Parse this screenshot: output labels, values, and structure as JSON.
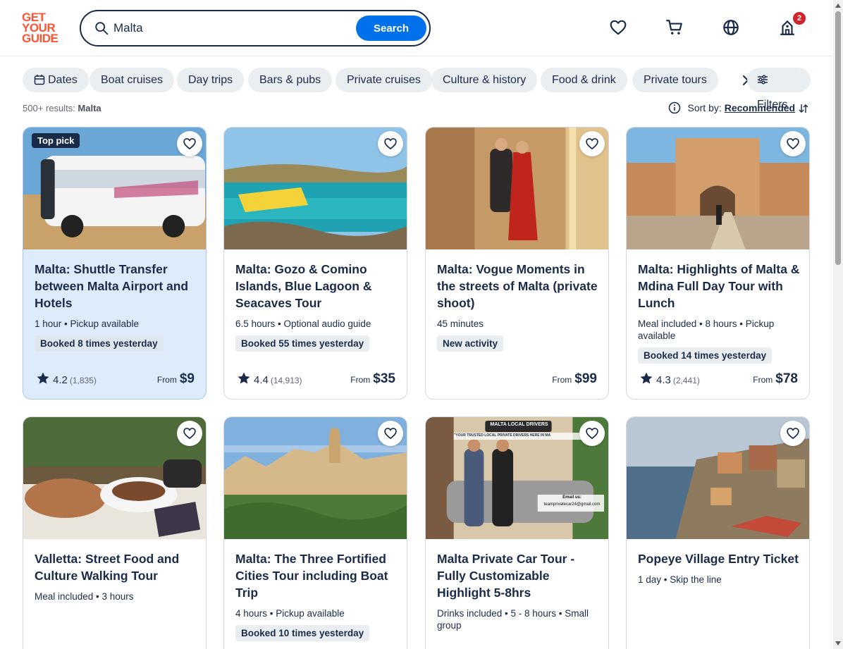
{
  "header": {
    "logo_lines": [
      "GET",
      "YOUR",
      "GUIDE"
    ],
    "search_value": "Malta",
    "search_button": "Search",
    "cart_badge": "2"
  },
  "chips": {
    "dates": "Dates",
    "items": [
      "Boat cruises",
      "Day trips",
      "Bars & pubs",
      "Private cruises",
      "Culture & history",
      "Food & drink",
      "Private tours"
    ],
    "filters": "Filters"
  },
  "results": {
    "count": "500+ results:",
    "query": "Malta"
  },
  "sort": {
    "label": "Sort by:",
    "value": "Recommended"
  },
  "cards": [
    {
      "badge": "Top pick",
      "title": "Malta: Shuttle Transfer between Malta Airport and Hotels",
      "meta": "1 hour • Pickup available",
      "booked": "Booked 8 times yesterday",
      "rating": "4.2",
      "reviews": "(1,835)",
      "from": "From",
      "price": "$9"
    },
    {
      "title": "Malta: Gozo & Comino Islands, Blue Lagoon & Seacaves Tour",
      "meta": "6.5 hours • Optional audio guide",
      "booked": "Booked 55 times yesterday",
      "rating": "4.4",
      "reviews": "(14,913)",
      "from": "From",
      "price": "$35"
    },
    {
      "title": "Malta: Vogue Moments in the streets of Malta (private shoot)",
      "meta": "45 minutes",
      "booked": "New activity",
      "from": "From",
      "price": "$99"
    },
    {
      "title": "Malta: Highlights of Malta & Mdina Full Day Tour with Lunch",
      "meta": "Meal included • 8 hours • Pickup available",
      "booked": "Booked 14 times yesterday",
      "rating": "4.3",
      "reviews": "(2,441)",
      "from": "From",
      "price": "$78"
    },
    {
      "title": "Valletta: Street Food and Culture Walking Tour",
      "meta": "Meal included • 3 hours"
    },
    {
      "title": "Malta: The Three Fortified Cities Tour including Boat Trip",
      "meta": "4 hours • Pickup available",
      "booked": "Booked 10 times yesterday"
    },
    {
      "title": "Malta Private Car Tour - Fully Customizable Highlight 5-8hrs",
      "meta": "Drinks included • 5 - 8 hours • Small group",
      "image_text": [
        "MALTA LOCAL DRIVERS",
        "\"YOUR TRUSTED LOCAL PRIVATE DRIVERS HERE IN MA",
        "Email us:",
        "teamprivatecar24@gmail.com"
      ]
    },
    {
      "title": "Popeye Village Entry Ticket",
      "meta": "1 day • Skip the line"
    }
  ],
  "colors": {
    "brand": "#ff5533",
    "accent": "#0071eb",
    "navy": "#1a2b49",
    "badge": "#d0232a"
  }
}
